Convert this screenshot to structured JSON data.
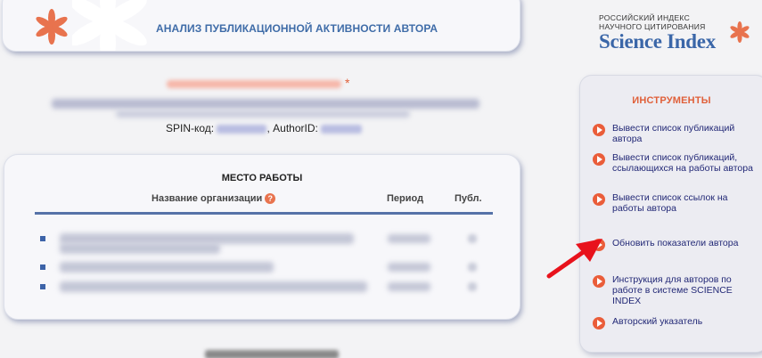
{
  "header": {
    "title": "АНАЛИЗ ПУБЛИКАЦИОННОЙ АКТИВНОСТИ АВТОРА"
  },
  "logo": {
    "line1": "РОССИЙСКИЙ ИНДЕКС",
    "line2": "НАУЧНОГО ЦИТИРОВАНИЯ",
    "name": "Science Index"
  },
  "author": {
    "spin_label": "SPIN-код:",
    "authorid_label": ", AuthorID:"
  },
  "workplace": {
    "title": "МЕСТО РАБОТЫ",
    "columns": [
      "Название организации",
      "Период",
      "Публ."
    ]
  },
  "tools": {
    "title": "ИНСТРУМЕНТЫ",
    "items": [
      "Вывести список публикаций автора",
      "Вывести список публикаций, ссылающихся на работы автора",
      "Вывести список ссылок на работы автора",
      "Обновить показатели автора",
      "Инструкция для авторов по работе в системе SCIENCE INDEX",
      "Авторский указатель"
    ]
  },
  "colors": {
    "accent": "#e0603a",
    "brand": "#3a66a8",
    "link": "#222876"
  }
}
